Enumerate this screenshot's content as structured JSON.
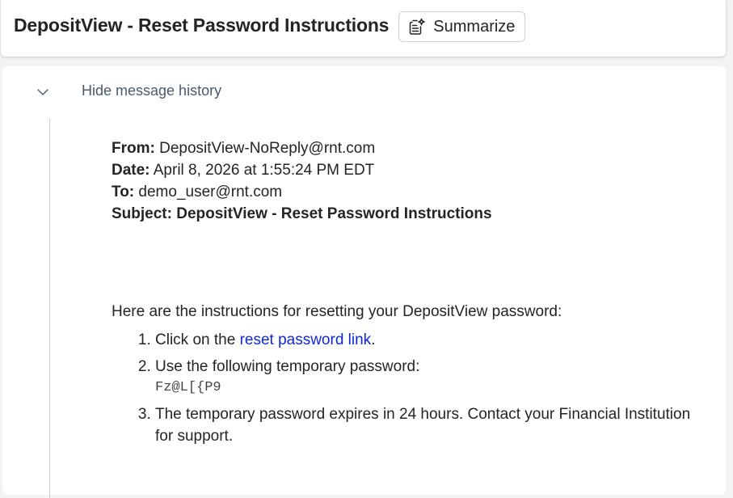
{
  "header": {
    "title": "DepositView - Reset Password Instructions",
    "summarize_label": "Summarize"
  },
  "history": {
    "toggle_label": "Hide message history"
  },
  "message": {
    "from_label": "From:",
    "from_value": "DepositView-NoReply@rnt.com",
    "date_label": "Date:",
    "date_value": "April 8, 2026 at 1:55:24 PM EDT",
    "to_label": "To:",
    "to_value": "demo_user@rnt.com",
    "subject_label": "Subject:",
    "subject_value": "DepositView - Reset Password Instructions",
    "intro": "Here are the instructions for resetting your DepositView password:",
    "steps": {
      "step1_prefix": "Click on the",
      "step1_link": "reset password link",
      "step1_suffix": ".",
      "step2_text": "Use the following temporary password:",
      "step2_code": "Fz@L[{P9",
      "step3_text": "The temporary password expires in 24 hours. Contact your Financial Institution for support."
    }
  },
  "colors": {
    "link": "#0f28d6",
    "text": "#242424",
    "muted": "#4a5a6a",
    "background": "#f3f3f3"
  },
  "icons": {
    "summarize": "sparkle-document-icon",
    "toggle": "chevron-down-icon"
  }
}
